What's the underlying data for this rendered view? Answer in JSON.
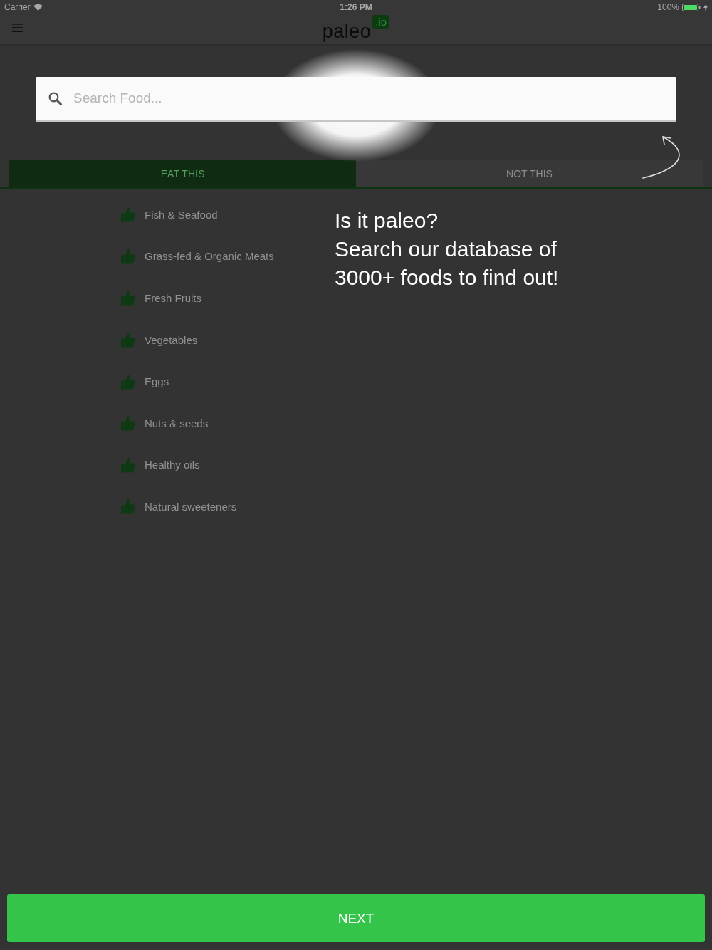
{
  "status_bar": {
    "carrier": "Carrier",
    "time": "1:26 PM",
    "battery": "100%",
    "charging": true
  },
  "header": {
    "logo": {
      "word": "paleo",
      "badge": ".io"
    }
  },
  "search": {
    "placeholder": "Search Food..."
  },
  "tabs": [
    {
      "label": "EAT THIS",
      "selected": true
    },
    {
      "label": "NOT THIS",
      "selected": false
    }
  ],
  "foods": [
    {
      "name": "Fish & Seafood"
    },
    {
      "name": "Grass-fed & Organic Meats"
    },
    {
      "name": "Fresh Fruits"
    },
    {
      "name": "Vegetables"
    },
    {
      "name": "Eggs"
    },
    {
      "name": "Nuts & seeds"
    },
    {
      "name": "Healthy oils"
    },
    {
      "name": "Natural sweeteners"
    }
  ],
  "coach_mark": {
    "lines": [
      "Is it paleo?",
      "Search our database of",
      "3000+ foods to find out!"
    ]
  },
  "next_button": {
    "label": "NEXT"
  }
}
